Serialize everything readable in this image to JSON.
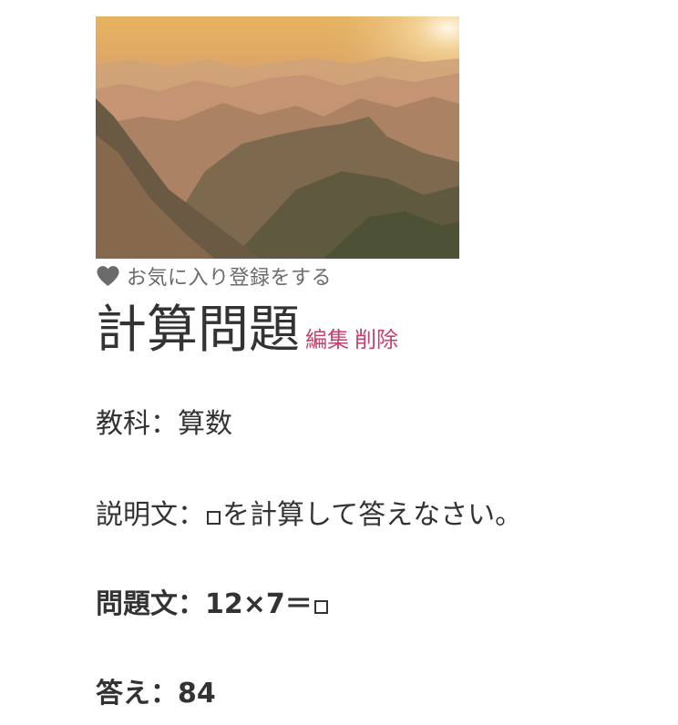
{
  "favorite": {
    "label": "お気に入り登録をする",
    "icon": "heart-icon",
    "icon_color": "#6b6b6b"
  },
  "quiz": {
    "title": "計算問題",
    "edit_label": "編集",
    "delete_label": "削除",
    "subject_label": "教科",
    "subject_value": "算数",
    "description_label": "説明文",
    "description_before": "",
    "description_after": "を計算して答えなさい。",
    "question_label": "問題文",
    "question_before": "12×7＝",
    "question_after": "",
    "answer_label": "答え",
    "answer_value": "84",
    "separator": "："
  },
  "colors": {
    "link": "#c2436b",
    "text": "#333333"
  }
}
